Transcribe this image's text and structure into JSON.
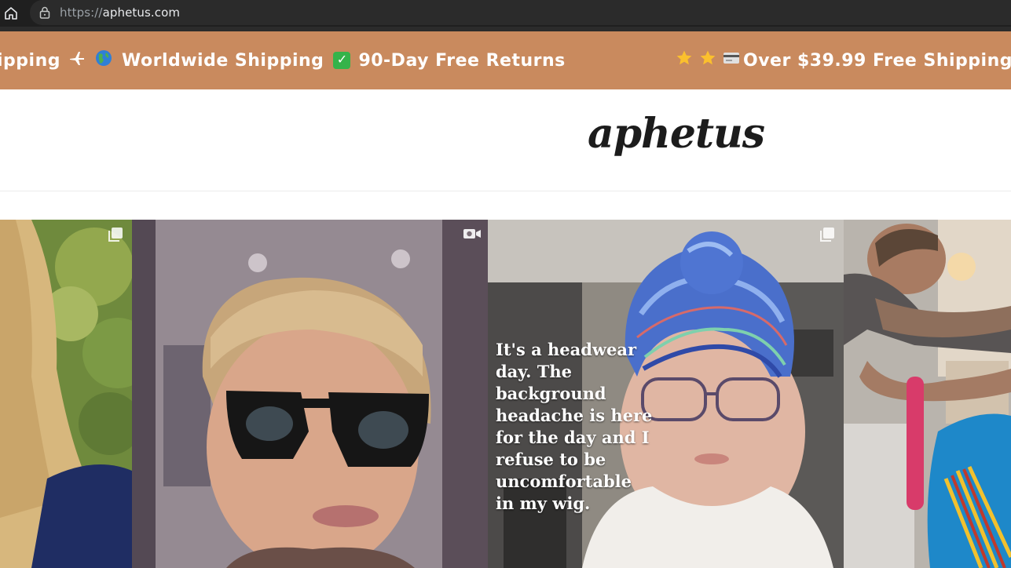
{
  "browser": {
    "url_scheme": "https://",
    "url_host": "aphetus.com"
  },
  "announcement": {
    "group1": {
      "text_a": "ipping",
      "text_b": "Worldwide Shipping",
      "text_c": "90-Day Free Returns"
    },
    "group2": {
      "text_a": "Over $39.99 Free Shipping"
    },
    "colors": {
      "bar": "#c98a5e",
      "text": "#ffffff"
    }
  },
  "header": {
    "logo": "aphetus"
  },
  "gallery": {
    "tiles": [
      {
        "icon": "multi-image-icon"
      },
      {
        "icon": "video-camera-icon"
      },
      {
        "icon": "multi-image-icon",
        "overlay_lines": [
          "It's a headwear",
          "day. The",
          "background",
          "headache is here",
          "for the day and I",
          "refuse to be",
          "uncomfortable",
          "in my wig."
        ]
      },
      {
        "icon": ""
      }
    ]
  }
}
